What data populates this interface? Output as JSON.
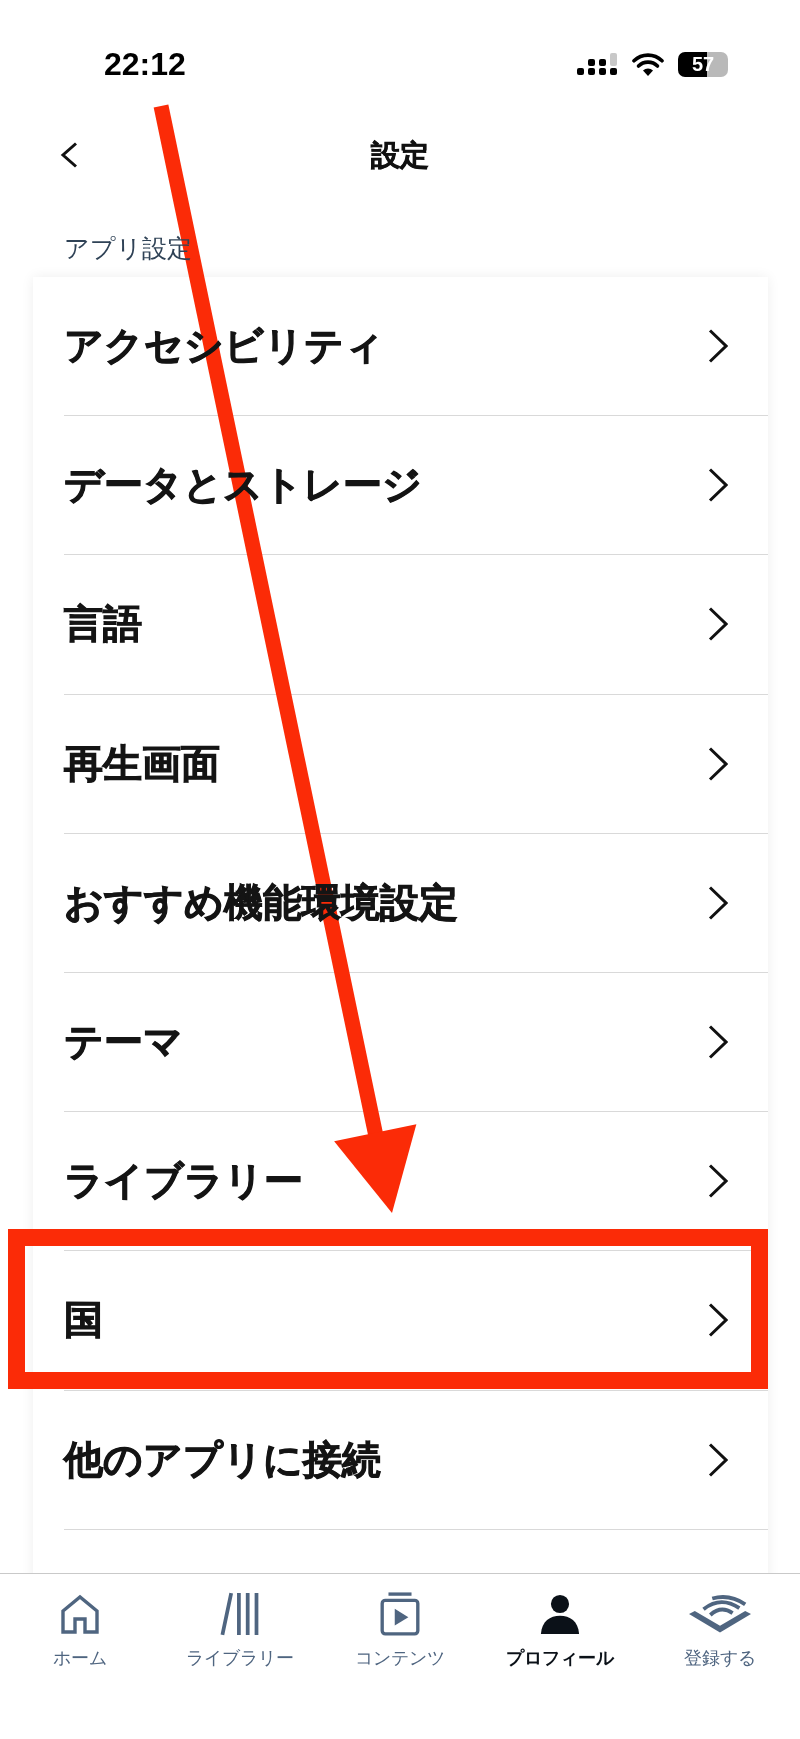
{
  "status_bar": {
    "time": "22:12",
    "battery": "57"
  },
  "header": {
    "title": "設定"
  },
  "section": {
    "title": "アプリ設定",
    "items": [
      {
        "label": "アクセシビリティ",
        "highlighted": false
      },
      {
        "label": "データとストレージ",
        "highlighted": false
      },
      {
        "label": "言語",
        "highlighted": false
      },
      {
        "label": "再生画面",
        "highlighted": false
      },
      {
        "label": "おすすめ機能環境設定",
        "highlighted": false
      },
      {
        "label": "テーマ",
        "highlighted": false
      },
      {
        "label": "ライブラリー",
        "highlighted": false
      },
      {
        "label": "国",
        "highlighted": true
      },
      {
        "label": "他のアプリに接続",
        "highlighted": false
      }
    ]
  },
  "tab_bar": {
    "tabs": [
      {
        "label": "ホーム",
        "kind": "home",
        "selected": false
      },
      {
        "label": "ライブラリー",
        "kind": "library",
        "selected": false
      },
      {
        "label": "コンテンツ",
        "kind": "content",
        "selected": false
      },
      {
        "label": "プロフィール",
        "kind": "profile",
        "selected": true
      },
      {
        "label": "登録する",
        "kind": "subscribe",
        "selected": false
      }
    ]
  }
}
